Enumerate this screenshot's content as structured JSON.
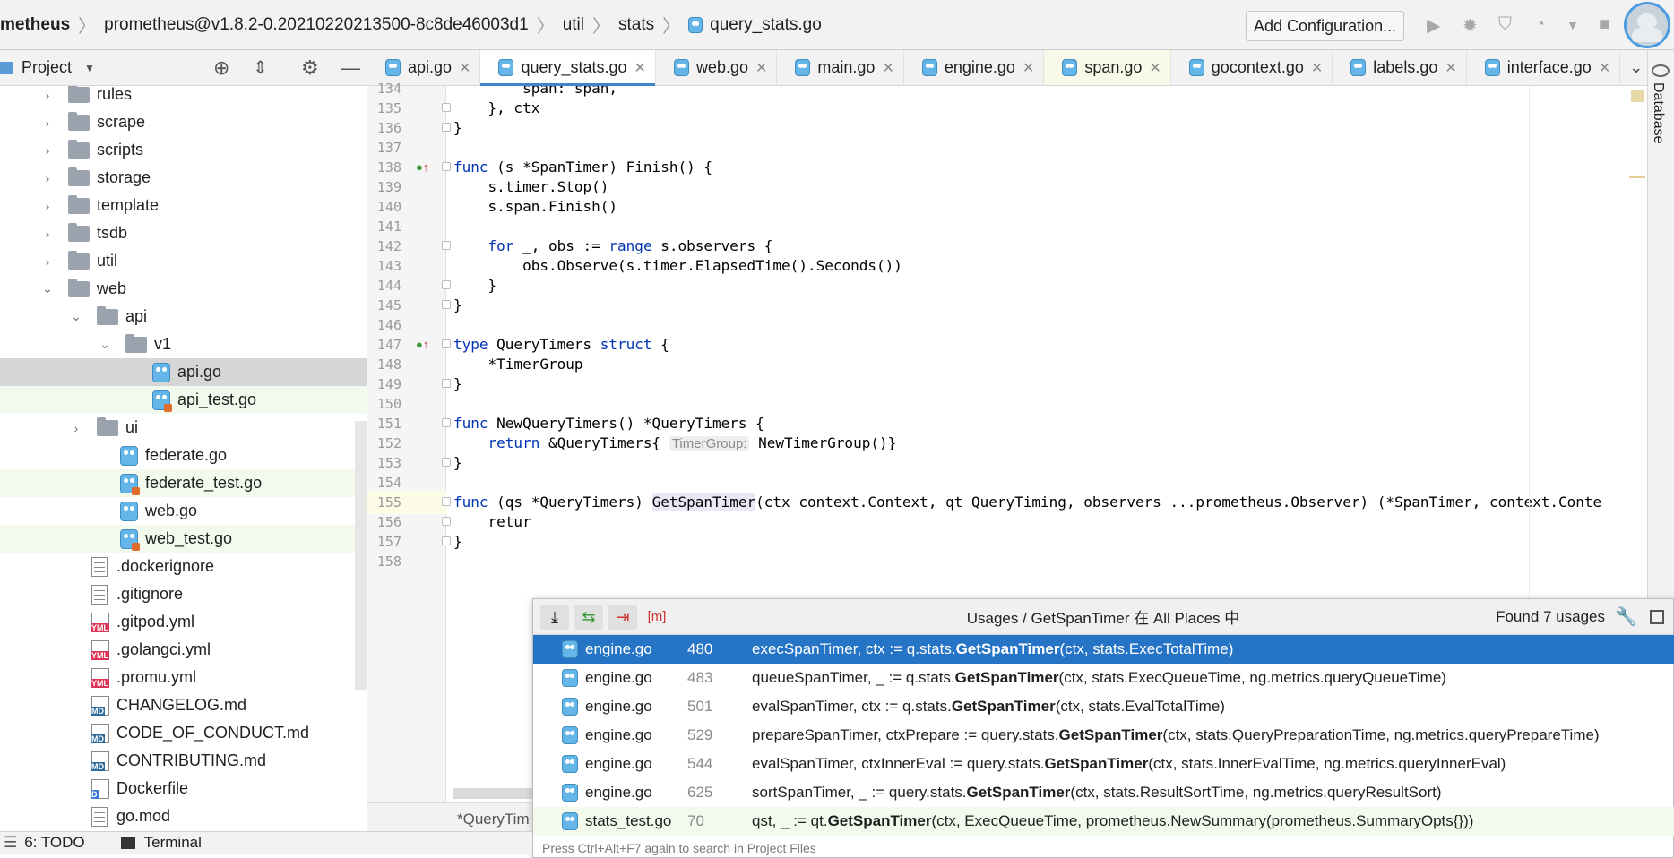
{
  "navbar": {
    "crumbs": [
      "metheus",
      "prometheus@v1.8.2-0.20210220213500-8c8de46003d1",
      "util",
      "stats",
      "query_stats.go"
    ],
    "add_config_label": "Add Configuration..."
  },
  "project": {
    "title": "Project",
    "tree": [
      {
        "label": "rules",
        "kind": "folder",
        "depth": 1,
        "expanded": false
      },
      {
        "label": "scrape",
        "kind": "folder",
        "depth": 1,
        "expanded": false
      },
      {
        "label": "scripts",
        "kind": "folder",
        "depth": 1,
        "expanded": false
      },
      {
        "label": "storage",
        "kind": "folder",
        "depth": 1,
        "expanded": false
      },
      {
        "label": "template",
        "kind": "folder",
        "depth": 1,
        "expanded": false
      },
      {
        "label": "tsdb",
        "kind": "folder",
        "depth": 1,
        "expanded": false
      },
      {
        "label": "util",
        "kind": "folder",
        "depth": 1,
        "expanded": false
      },
      {
        "label": "web",
        "kind": "folder",
        "depth": 1,
        "expanded": true
      },
      {
        "label": "api",
        "kind": "folder",
        "depth": 2,
        "expanded": true
      },
      {
        "label": "v1",
        "kind": "folder",
        "depth": 3,
        "expanded": true
      },
      {
        "label": "api.go",
        "kind": "go",
        "depth": 4
      },
      {
        "label": "api_test.go",
        "kind": "gotest",
        "depth": 4
      },
      {
        "label": "ui",
        "kind": "folder",
        "depth": 2,
        "expanded": false
      },
      {
        "label": "federate.go",
        "kind": "go",
        "depth": 3
      },
      {
        "label": "federate_test.go",
        "kind": "gotest",
        "depth": 3
      },
      {
        "label": "web.go",
        "kind": "go",
        "depth": 3
      },
      {
        "label": "web_test.go",
        "kind": "gotest",
        "depth": 3
      },
      {
        "label": ".dockerignore",
        "kind": "txt",
        "depth": 2
      },
      {
        "label": ".gitignore",
        "kind": "txt",
        "depth": 2
      },
      {
        "label": ".gitpod.yml",
        "kind": "yml",
        "depth": 2
      },
      {
        "label": ".golangci.yml",
        "kind": "yml",
        "depth": 2
      },
      {
        "label": ".promu.yml",
        "kind": "yml",
        "depth": 2
      },
      {
        "label": "CHANGELOG.md",
        "kind": "md",
        "depth": 2
      },
      {
        "label": "CODE_OF_CONDUCT.md",
        "kind": "md",
        "depth": 2
      },
      {
        "label": "CONTRIBUTING.md",
        "kind": "md",
        "depth": 2
      },
      {
        "label": "Dockerfile",
        "kind": "docker",
        "depth": 2
      },
      {
        "label": "go.mod",
        "kind": "txt",
        "depth": 2
      }
    ]
  },
  "tabs": [
    {
      "label": "api.go",
      "active": false
    },
    {
      "label": "query_stats.go",
      "active": true
    },
    {
      "label": "web.go",
      "active": false
    },
    {
      "label": "main.go",
      "active": false
    },
    {
      "label": "engine.go",
      "active": false
    },
    {
      "label": "span.go",
      "active": false
    },
    {
      "label": "gocontext.go",
      "active": false
    },
    {
      "label": "labels.go",
      "active": false
    },
    {
      "label": "interface.go",
      "active": false
    }
  ],
  "editor": {
    "lines": [
      {
        "n": "134",
        "code": "        span: span,"
      },
      {
        "n": "135",
        "code": "    }, ctx"
      },
      {
        "n": "136",
        "code": "}"
      },
      {
        "n": "137",
        "code": ""
      },
      {
        "n": "138",
        "code": "func (s *SpanTimer) Finish() {"
      },
      {
        "n": "139",
        "code": "    s.timer.Stop()"
      },
      {
        "n": "140",
        "code": "    s.span.Finish()"
      },
      {
        "n": "141",
        "code": ""
      },
      {
        "n": "142",
        "code": "    for _, obs := range s.observers {"
      },
      {
        "n": "143",
        "code": "        obs.Observe(s.timer.ElapsedTime().Seconds())"
      },
      {
        "n": "144",
        "code": "    }"
      },
      {
        "n": "145",
        "code": "}"
      },
      {
        "n": "146",
        "code": ""
      },
      {
        "n": "147",
        "code": "type QueryTimers struct {"
      },
      {
        "n": "148",
        "code": "    *TimerGroup"
      },
      {
        "n": "149",
        "code": "}"
      },
      {
        "n": "150",
        "code": ""
      },
      {
        "n": "151",
        "code": "func NewQueryTimers() *QueryTimers {"
      },
      {
        "n": "152",
        "code": "    return &QueryTimers{"
      },
      {
        "n": "153",
        "code": "}"
      },
      {
        "n": "154",
        "code": ""
      },
      {
        "n": "155",
        "code": "func (qs *QueryTimers) GetSpanTimer(ctx context.Context, qt QueryTiming, observers ...prometheus.Observer) (*SpanTimer, context.Conte"
      },
      {
        "n": "156",
        "code": "    retur"
      },
      {
        "n": "157",
        "code": "}"
      },
      {
        "n": "158",
        "code": ""
      }
    ],
    "param_hint": "TimerGroup:",
    "line152_tail": "NewTimerGroup()}",
    "bottom_tab": "*QueryTim"
  },
  "usages": {
    "title": "Usages / GetSpanTimer 在 All Places 中",
    "found": "Found 7 usages",
    "rows": [
      {
        "file": "engine.go",
        "line": "480",
        "pre": "execSpanTimer, ctx := q.stats.",
        "fn": "GetSpanTimer",
        "post": "(ctx, stats.ExecTotalTime)"
      },
      {
        "file": "engine.go",
        "line": "483",
        "pre": "queueSpanTimer, _ := q.stats.",
        "fn": "GetSpanTimer",
        "post": "(ctx, stats.ExecQueueTime, ng.metrics.queryQueueTime)"
      },
      {
        "file": "engine.go",
        "line": "501",
        "pre": "evalSpanTimer, ctx := q.stats.",
        "fn": "GetSpanTimer",
        "post": "(ctx, stats.EvalTotalTime)"
      },
      {
        "file": "engine.go",
        "line": "529",
        "pre": "prepareSpanTimer, ctxPrepare := query.stats.",
        "fn": "GetSpanTimer",
        "post": "(ctx, stats.QueryPreparationTime, ng.metrics.queryPrepareTime)"
      },
      {
        "file": "engine.go",
        "line": "544",
        "pre": "evalSpanTimer, ctxInnerEval := query.stats.",
        "fn": "GetSpanTimer",
        "post": "(ctx, stats.InnerEvalTime, ng.metrics.queryInnerEval)"
      },
      {
        "file": "engine.go",
        "line": "625",
        "pre": "sortSpanTimer, _ := query.stats.",
        "fn": "GetSpanTimer",
        "post": "(ctx, stats.ResultSortTime, ng.metrics.queryResultSort)"
      },
      {
        "file": "stats_test.go",
        "line": "70",
        "pre": "qst, _ := qt.",
        "fn": "GetSpanTimer",
        "post": "(ctx, ExecQueueTime, prometheus.NewSummary(prometheus.SummaryOpts{}))"
      }
    ],
    "footer": "Press Ctrl+Alt+F7 again to search in Project Files"
  },
  "bottom": {
    "todo": "6: TODO",
    "terminal": "Terminal",
    "database": "Database"
  }
}
